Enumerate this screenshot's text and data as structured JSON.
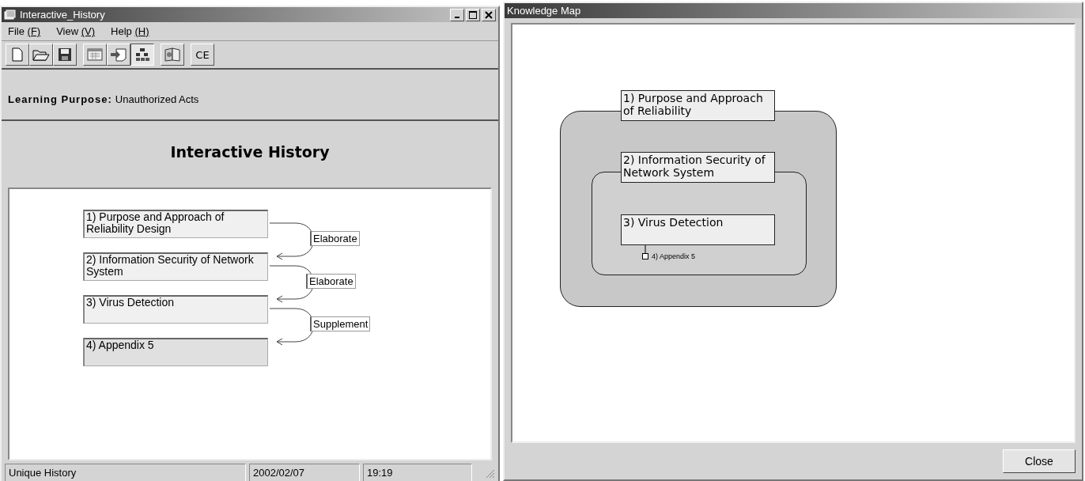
{
  "history_window": {
    "title": "Interactive_History",
    "menu": [
      {
        "label": "File",
        "shortcut": "(F)"
      },
      {
        "label": "View",
        "shortcut": "(V)"
      },
      {
        "label": "Help",
        "shortcut": "(H)"
      }
    ],
    "toolbar": [
      {
        "kind": "new",
        "pressed": false
      },
      {
        "kind": "open",
        "pressed": false
      },
      {
        "kind": "save",
        "pressed": false
      },
      {
        "kind": "calendar",
        "pressed": false
      },
      {
        "kind": "import",
        "pressed": false
      },
      {
        "kind": "tree",
        "pressed": true
      },
      {
        "kind": "book",
        "pressed": false
      },
      {
        "kind": "text",
        "label": "CE",
        "pressed": false
      }
    ],
    "learning_purpose": {
      "label": "Learning Purpose:",
      "value": "Unauthorized Acts"
    },
    "heading": "Interactive History",
    "nodes": [
      {
        "label": "1) Purpose and Approach of Reliability Design",
        "selected": false
      },
      {
        "label": "2) Information Security of Network System",
        "selected": false
      },
      {
        "label": "3) Virus Detection",
        "selected": false
      },
      {
        "label": "4) Appendix 5",
        "selected": true
      }
    ],
    "links": [
      {
        "label": "Elaborate"
      },
      {
        "label": "Elaborate"
      },
      {
        "label": "Supplement"
      }
    ],
    "status_bar": [
      "Unique History",
      "2002/02/07",
      "19:19"
    ]
  },
  "map_window": {
    "title": "Knowledge Map",
    "map": {
      "label": "1) Purpose and Approach of Reliability",
      "children": [
        {
          "label": "2) Information Security of Network System",
          "children": [
            {
              "label": "3) Virus Detection",
              "children": [
                {
                  "label": "4) Appendix 5"
                }
              ]
            }
          ]
        }
      ]
    },
    "close_button": "Close"
  }
}
